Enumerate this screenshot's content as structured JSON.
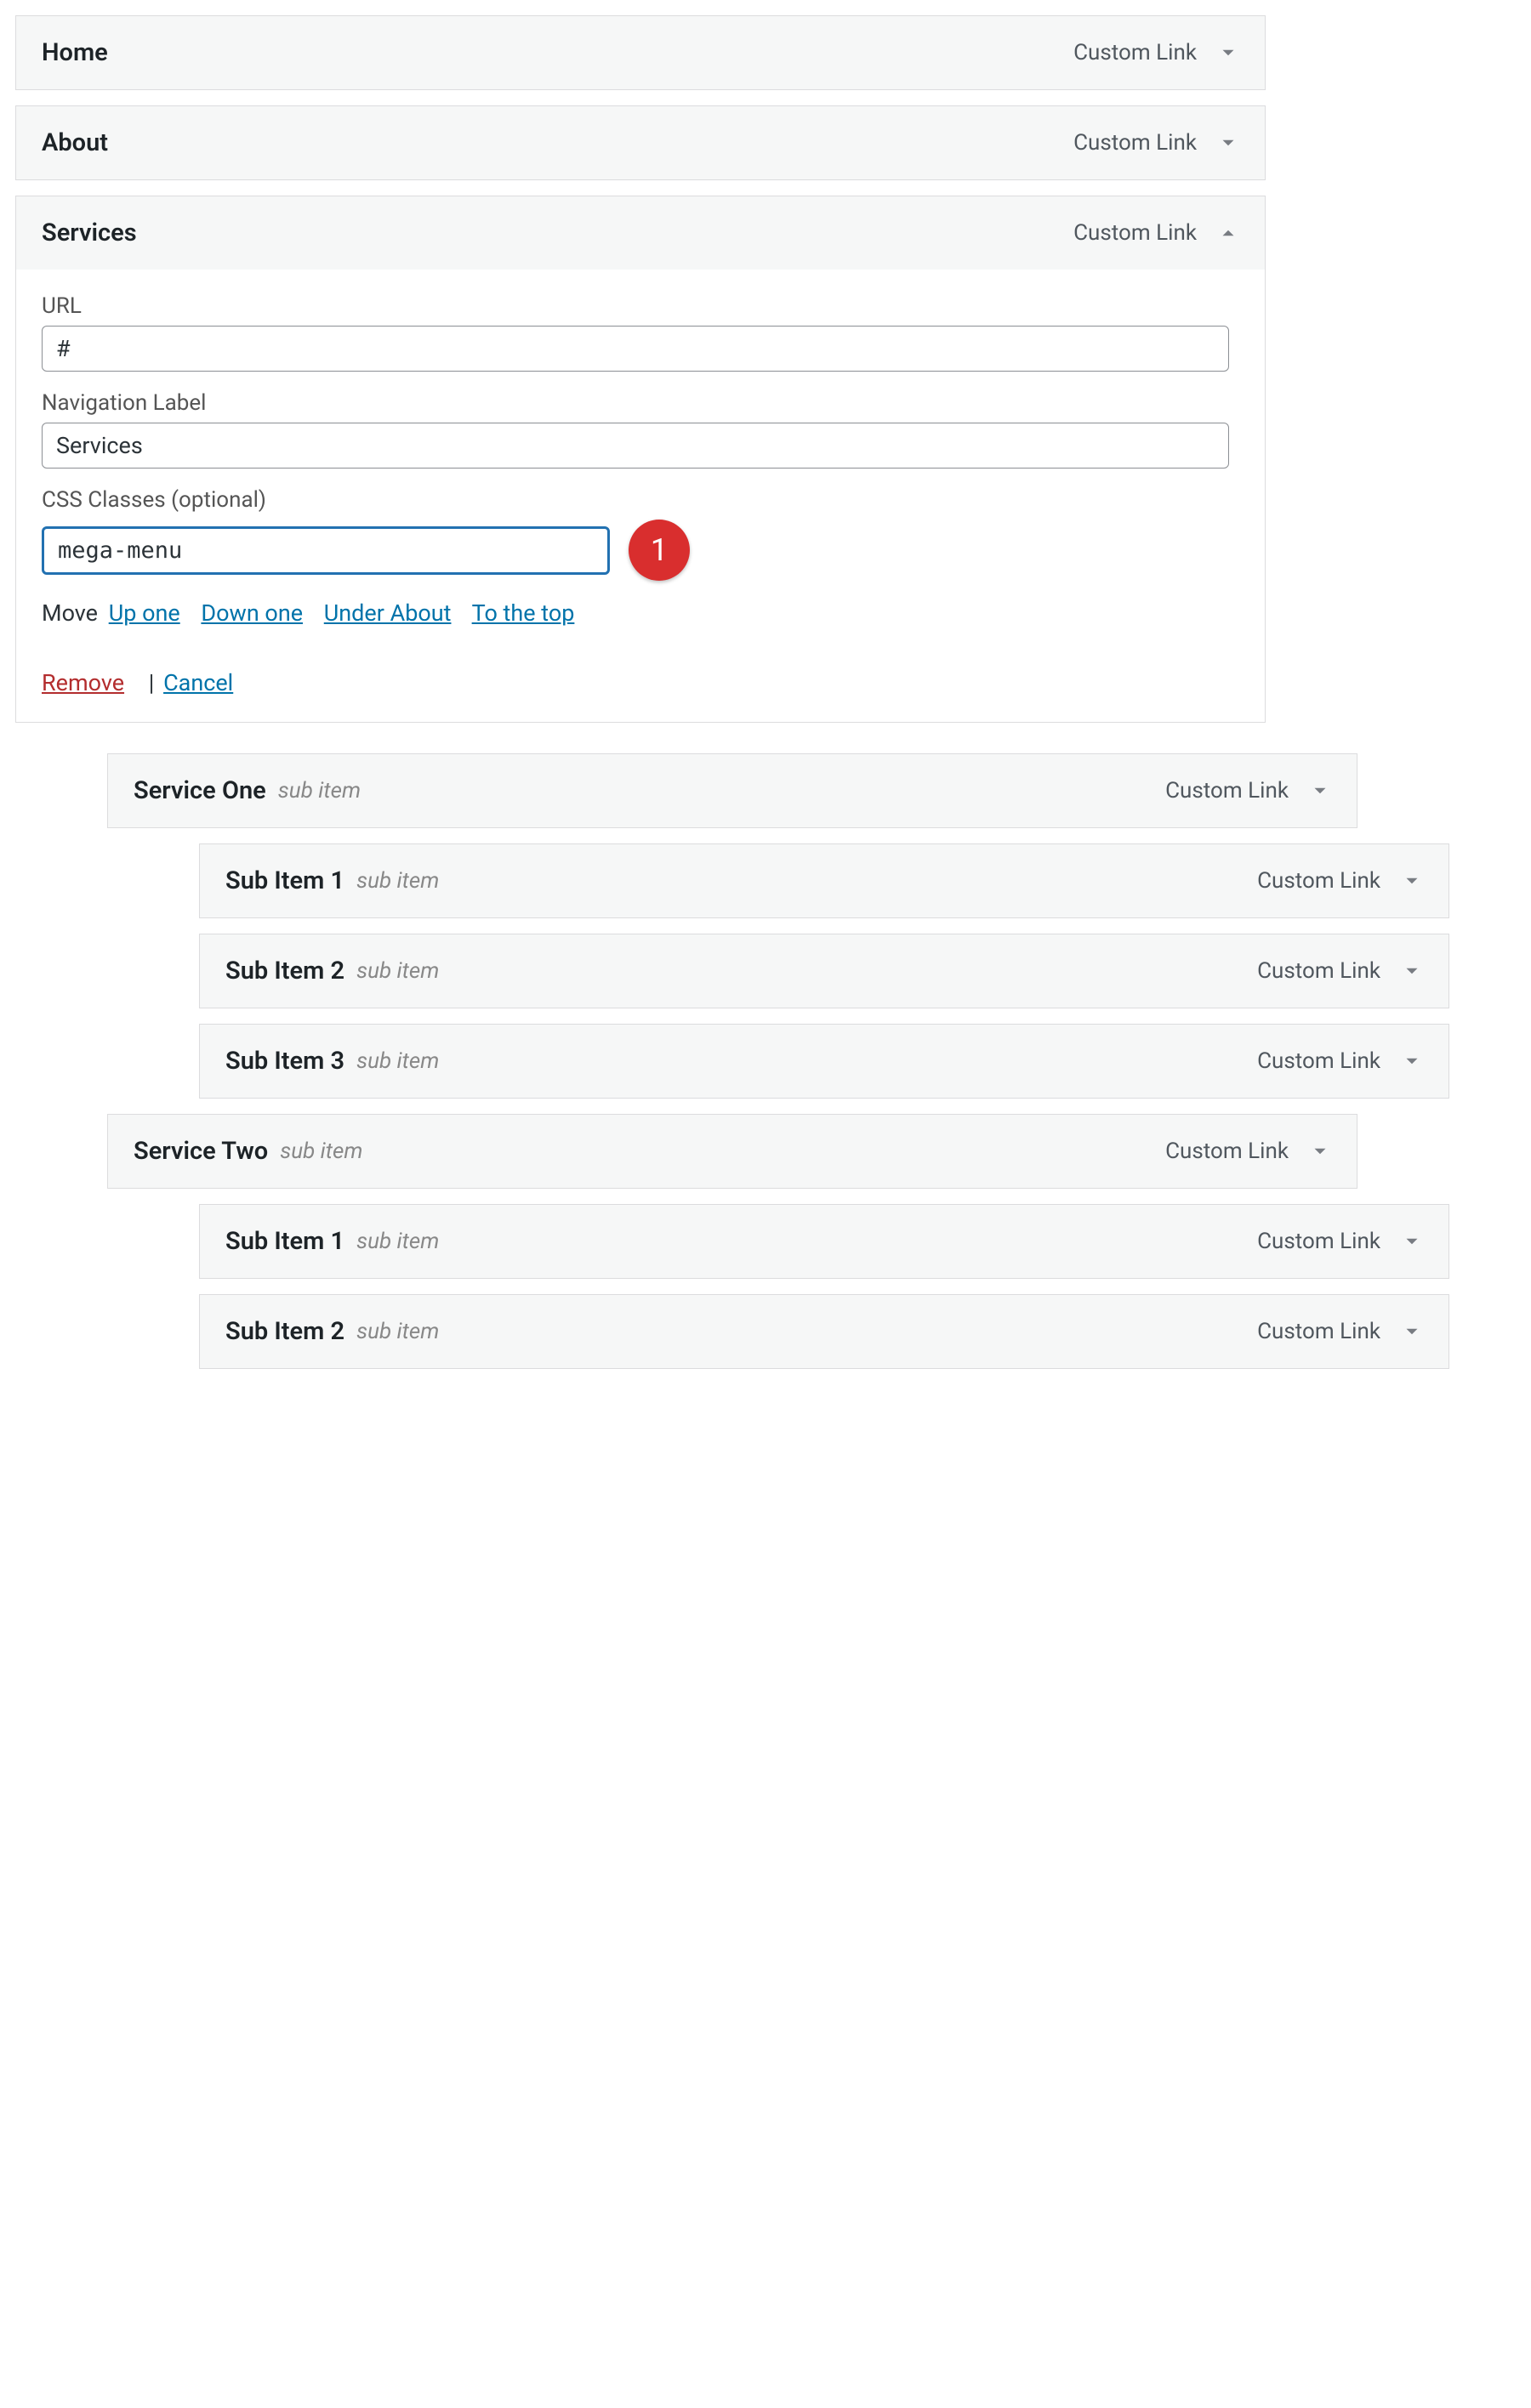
{
  "type_label": "Custom Link",
  "sub_item_text": "sub item",
  "annotation": {
    "number": "1"
  },
  "expanded": {
    "title": "Services",
    "fields": {
      "url_label": "URL",
      "url_value": "#",
      "nav_label_label": "Navigation Label",
      "nav_label_value": "Services",
      "css_label": "CSS Classes (optional)",
      "css_value": "mega-menu"
    },
    "move": {
      "label": "Move",
      "up_one": "Up one",
      "down_one": "Down one",
      "under_about": "Under About",
      "to_top": "To the top"
    },
    "actions": {
      "remove": "Remove",
      "sep": "|",
      "cancel": "Cancel"
    }
  },
  "items": [
    {
      "title": "Home",
      "depth": 0
    },
    {
      "title": "About",
      "depth": 0
    },
    {
      "title": "Service One",
      "depth": 1,
      "sub": true
    },
    {
      "title": "Sub Item 1",
      "depth": 2,
      "sub": true
    },
    {
      "title": "Sub Item 2",
      "depth": 2,
      "sub": true
    },
    {
      "title": "Sub Item 3",
      "depth": 2,
      "sub": true
    },
    {
      "title": "Service Two",
      "depth": 1,
      "sub": true
    },
    {
      "title": "Sub Item 1",
      "depth": 2,
      "sub": true
    },
    {
      "title": "Sub Item 2",
      "depth": 2,
      "sub": true
    }
  ]
}
